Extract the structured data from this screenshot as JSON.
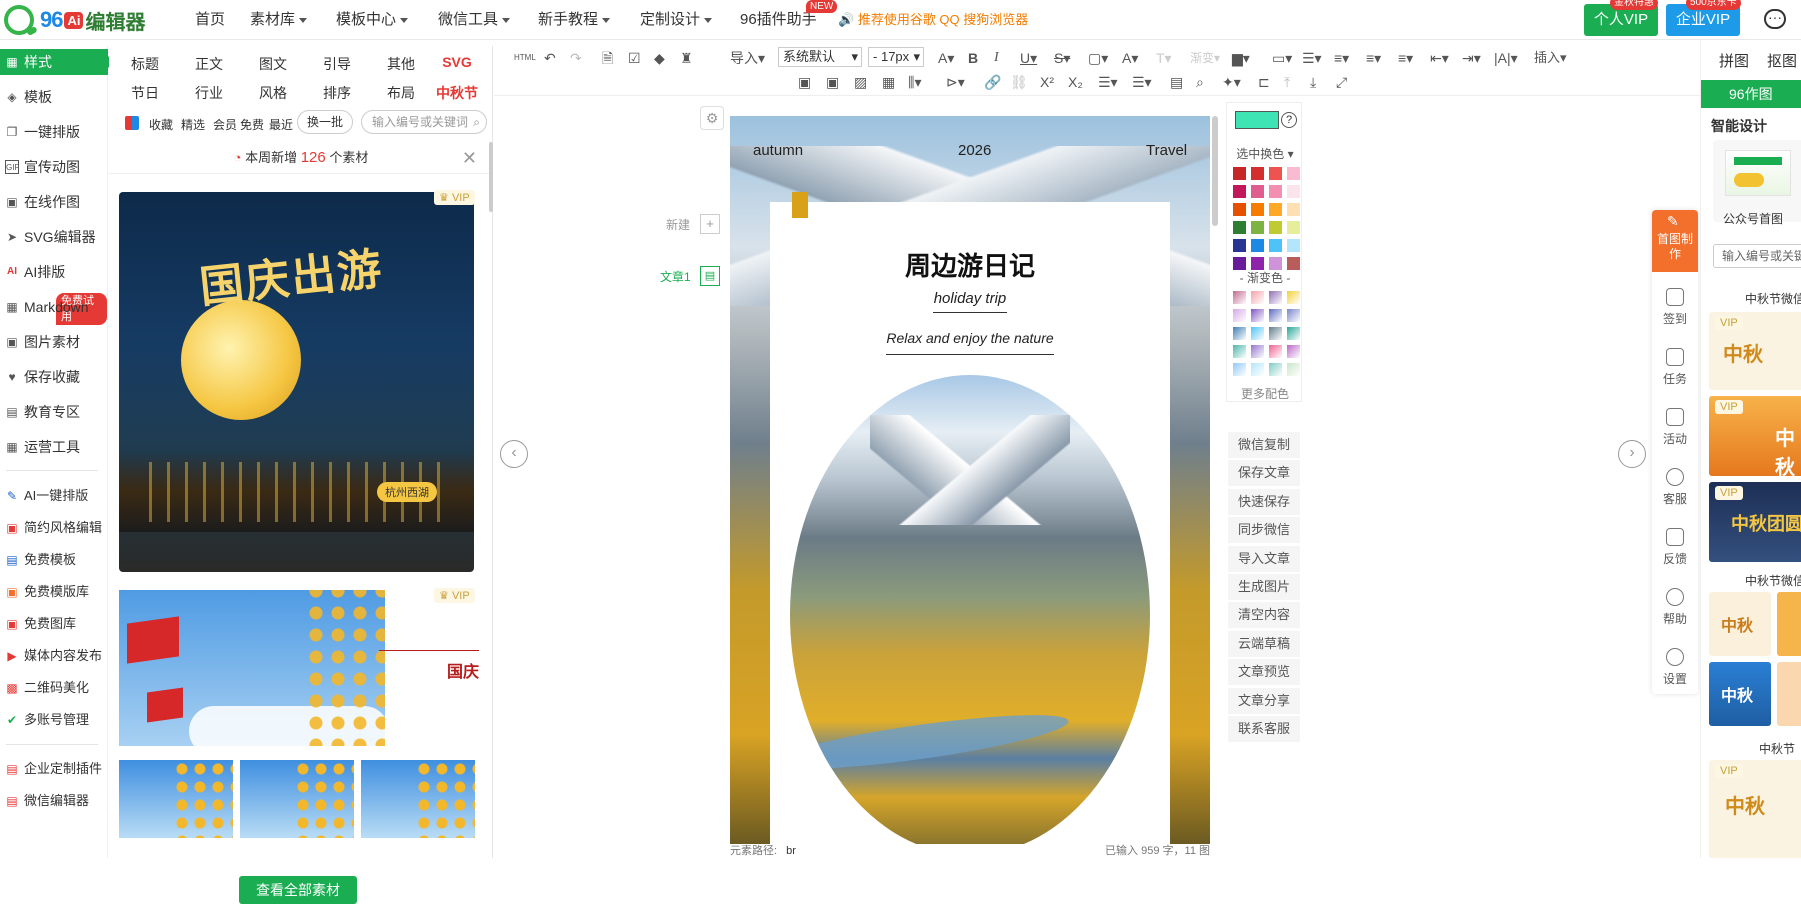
{
  "logo": {
    "num": "96",
    "ai": "Ai",
    "name": "编辑器"
  },
  "nav": {
    "home": "首页",
    "material": "素材库",
    "template": "模板中心",
    "wechat_tools": "微信工具",
    "tutorial": "新手教程",
    "custom": "定制设计",
    "plugin": "96插件助手",
    "new_badge": "NEW",
    "recommend": "推荐使用谷歌 QQ 搜狗浏览器",
    "personal_vip": "个人VIP",
    "personal_badge": "金秋特惠",
    "enterprise_vip": "企业VIP",
    "enterprise_badge": "500京东卡"
  },
  "sidebar": {
    "items": [
      {
        "label": "样式",
        "icon": "grid-icon"
      },
      {
        "label": "模板",
        "icon": "layers-icon"
      },
      {
        "label": "一键排版",
        "icon": "copy-icon"
      },
      {
        "label": "宣传动图",
        "icon": "gif-icon"
      },
      {
        "label": "在线作图",
        "icon": "image-icon"
      },
      {
        "label": "SVG编辑器",
        "icon": "cursor-icon"
      },
      {
        "label": "AI排版",
        "icon": "ai-icon"
      },
      {
        "label": "Markdown",
        "icon": "grid-icon"
      },
      {
        "label": "图片素材",
        "icon": "image-icon"
      },
      {
        "label": "保存收藏",
        "icon": "heart-icon"
      },
      {
        "label": "教育专区",
        "icon": "chat-icon"
      },
      {
        "label": "运营工具",
        "icon": "grid-icon"
      }
    ],
    "free_badge": "免费试用",
    "tools": [
      {
        "label": "AI一键排版",
        "color": "#1e63c9"
      },
      {
        "label": "简约风格编辑",
        "color": "#e53935"
      },
      {
        "label": "免费模板",
        "color": "#1e63c9"
      },
      {
        "label": "免费模版库",
        "color": "#f26f2c"
      },
      {
        "label": "免费图库",
        "color": "#e53935"
      },
      {
        "label": "媒体内容发布",
        "color": "#e53935"
      },
      {
        "label": "二维码美化",
        "color": "#e53935"
      },
      {
        "label": "多账号管理",
        "color": "#1aad52"
      }
    ],
    "bottom": [
      {
        "label": "企业定制插件"
      },
      {
        "label": "微信编辑器"
      }
    ]
  },
  "material": {
    "cats_row1": [
      "标题",
      "正文",
      "图文",
      "引导",
      "其他",
      "SVG"
    ],
    "cats_row2": [
      "节日",
      "行业",
      "风格",
      "排序",
      "布局",
      "中秋节"
    ],
    "filters": [
      "收藏",
      "精选",
      "会员",
      "免费",
      "最近"
    ],
    "swap": "换一批",
    "search_placeholder": "输入编号或关键词",
    "week_prefix": "本周新增",
    "week_count": "126",
    "week_suffix": "个素材",
    "vip": "VIP",
    "card1_title": "国庆出游",
    "card1_tag": "杭州西湖",
    "card2_title": "国庆",
    "view_all": "查看全部素材"
  },
  "toolbar": {
    "import": "导入",
    "font": "系统默认",
    "size": "17px",
    "insert": "插入"
  },
  "editor": {
    "new_label": "新建",
    "article_label": "文章1",
    "top_left": "autumn",
    "top_mid": "2026",
    "top_right": "Travel",
    "title": "周边游日记",
    "subtitle": "holiday trip",
    "tagline": "Relax and enjoy the nature",
    "path_label": "元素路径:",
    "path_value": "br",
    "count_text": "已输入 959 字，11 图"
  },
  "colorpanel": {
    "current": "#3ee4b3",
    "select_label": "选中换色",
    "gradient_label": "- 渐变色 -",
    "more": "更多配色",
    "row_colors": [
      [
        "#c62828",
        "#d32f2f",
        "#ef5350",
        "#f8bbd0"
      ],
      [
        "#c2185b",
        "#e05e8f",
        "#f48fb1",
        "#fce4ec"
      ],
      [
        "#e65100",
        "#f57c00",
        "#ffa726",
        "#ffe0b2"
      ],
      [
        "#2e7d32",
        "#7cb342",
        "#c0ca33",
        "#e6ee9c"
      ],
      [
        "#283593",
        "#1e88e5",
        "#4fc3f7",
        "#b3e5fc"
      ],
      [
        "#6a1b9a",
        "#8e24aa",
        "#ce93d8",
        "#b85c5c"
      ]
    ],
    "grad_colors": [
      [
        "#c06b8f",
        "#f4a3a8",
        "#8e6fb5",
        "#f2d13a"
      ],
      [
        "#d7a9e6",
        "#7e57c2",
        "#5c6bc0",
        "#7986cb"
      ],
      [
        "#3f7fb5",
        "#4fc3f7",
        "#607d8b",
        "#26a69a"
      ],
      [
        "#4db6ac",
        "#9575cd",
        "#f06292",
        "#ba68c8"
      ],
      [
        "#90caf9",
        "#b3e5fc",
        "#80cbc4",
        "#c8e6c9"
      ]
    ]
  },
  "actions": [
    "微信复制",
    "保存文章",
    "快速保存",
    "同步微信",
    "导入文章",
    "生成图片",
    "清空内容",
    "云端草稿",
    "文章预览",
    "文章分享",
    "联系客服"
  ],
  "rightrail": {
    "first": "首图制作",
    "items": [
      "签到",
      "任务",
      "活动",
      "客服",
      "反馈",
      "帮助",
      "设置"
    ]
  },
  "farright": {
    "tab1": "拼图",
    "tab2": "抠图",
    "zuotu": "96作图",
    "smart": "智能设计",
    "gz": "公众号首图",
    "search": "输入编号或关键词",
    "sec1": "中秋节微信",
    "sec2": "中秋节微信",
    "sec3": "中秋节",
    "thumb_text": "中秋",
    "thumb_text2": "中秋团圆"
  }
}
